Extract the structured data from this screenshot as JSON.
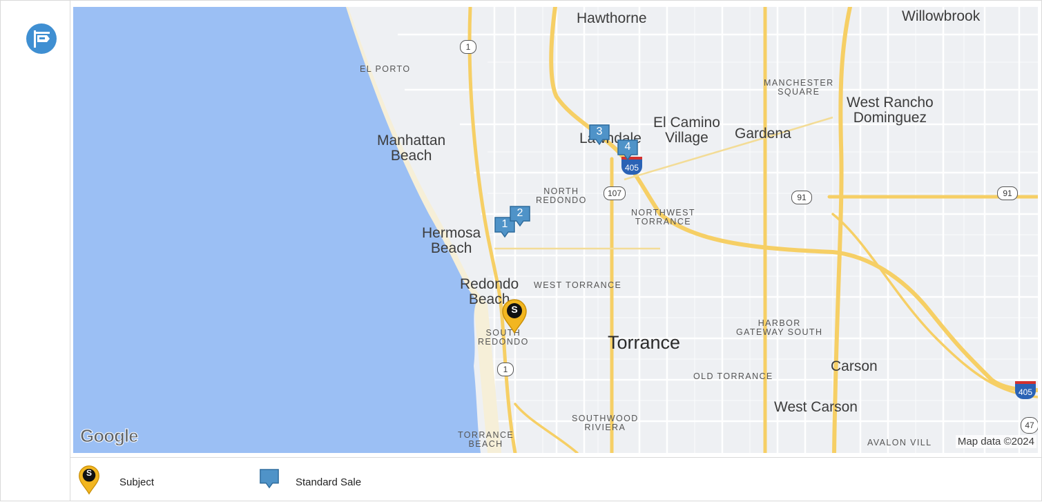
{
  "map": {
    "places": {
      "hawthorne": "Hawthorne",
      "willowbrook": "Willowbrook",
      "el_porto": "EL PORTO",
      "manchester_square": "MANCHESTER\nSQUARE",
      "west_rancho": "West Rancho\nDominguez",
      "manhattan_beach": "Manhattan\nBeach",
      "lawndale": "Lawndale",
      "el_camino": "El Camino\nVillage",
      "gardena": "Gardena",
      "north_redondo": "NORTH\nREDONDO",
      "northwest_torrance": "NORTHWEST\nTORRANCE",
      "hermosa_beach": "Hermosa\nBeach",
      "redondo_beach": "Redondo\nBeach",
      "west_torrance": "WEST TORRANCE",
      "south_redondo": "SOUTH\nREDONDO",
      "harbor_gateway": "HARBOR\nGATEWAY SOUTH",
      "torrance": "Torrance",
      "carson": "Carson",
      "old_torrance": "OLD TORRANCE",
      "west_carson": "West Carson",
      "southwood_riviera": "SOUTHWOOD\nRIVIERA",
      "torrance_beach": "TORRANCE\nBEACH",
      "avalon": "AVALON VILL"
    },
    "shields": {
      "route_1_north": "1",
      "route_1_south": "1",
      "route_107": "107",
      "route_91_center": "91",
      "route_91_east": "91",
      "i405_north": "405",
      "i405_east": "405",
      "route_47": "47"
    },
    "markers": {
      "sale_1": "1",
      "sale_2": "2",
      "sale_3": "3",
      "sale_4": "4",
      "subject": "S"
    },
    "attribution_logo": "Google",
    "map_data": "Map data ©2024"
  },
  "legend": {
    "subject_label": "Subject",
    "subject_icon_letter": "S",
    "standard_sale_label": "Standard Sale"
  },
  "colors": {
    "ocean": "#9bbff4",
    "land": "#eef0f3",
    "highway": "#f6cf65",
    "street": "#ffffff",
    "sale_marker": "#4f93c8",
    "subject_marker": "#f2b620",
    "header_icon": "#3f8fd2"
  }
}
